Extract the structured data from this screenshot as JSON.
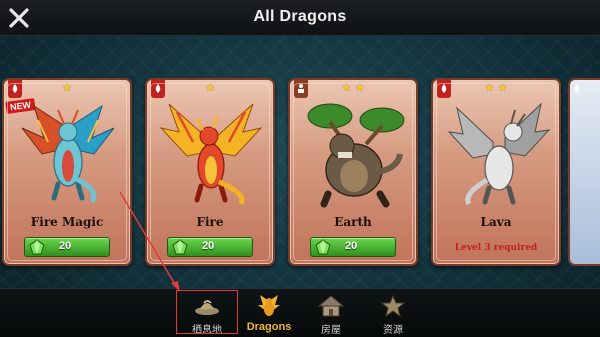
{
  "header": {
    "title": "All Dragons",
    "close_icon": "close-icon"
  },
  "cards": [
    {
      "name": "Fire Magic",
      "element": "fire",
      "stars": "★",
      "badge": "NEW",
      "price": "20",
      "price_icon": "gem-icon",
      "body_color": "#6ec5d4",
      "wing_color": "#d8502a"
    },
    {
      "name": "Fire",
      "element": "fire",
      "stars": "★",
      "price": "20",
      "price_icon": "gem-icon",
      "body_color": "#e4482a",
      "wing_color": "#f4b322"
    },
    {
      "name": "Earth",
      "element": "earth",
      "stars": "★ ★",
      "price": "20",
      "price_icon": "gem-icon",
      "body_color": "#6b5a45",
      "wing_color": "#3d8a2a"
    },
    {
      "name": "Lava",
      "element": "fire",
      "stars": "★ ★",
      "requirement": "Level 3 required",
      "body_color": "#e6e6e6",
      "wing_color": "#8f8f8f"
    }
  ],
  "nav": {
    "tabs": [
      {
        "label": "栖息地",
        "icon": "habitat-icon"
      },
      {
        "label": "Dragons",
        "icon": "dragon-icon",
        "active": true
      },
      {
        "label": "房屋",
        "icon": "house-icon"
      },
      {
        "label": "资源",
        "icon": "star-icon"
      }
    ]
  },
  "colors": {
    "accent": "#f1b52c",
    "price_green": "#3ea826",
    "card_red": "#c0735a",
    "highlight": "#e03b3b"
  }
}
